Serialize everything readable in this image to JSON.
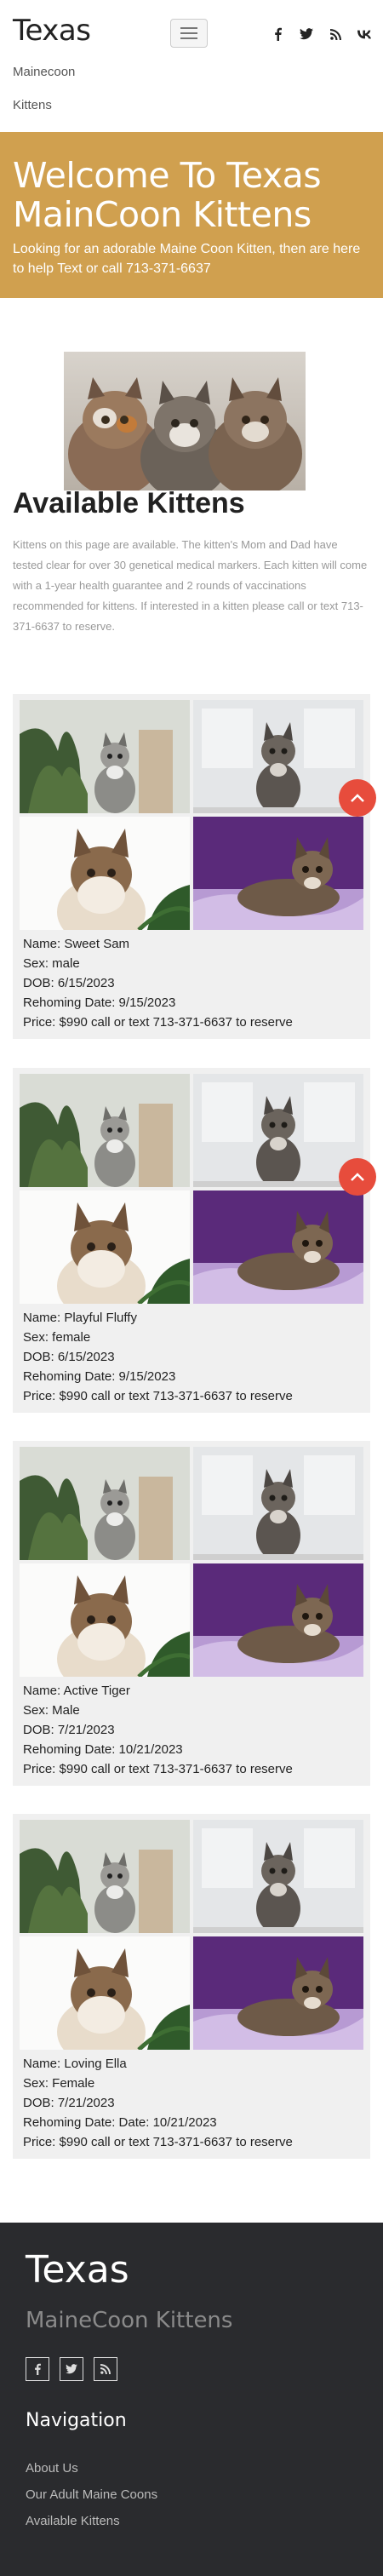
{
  "header": {
    "brand": "Texas",
    "nav": [
      "Mainecoon",
      "Kittens"
    ],
    "social_icons": [
      "facebook-icon",
      "twitter-icon",
      "rss-icon",
      "vk-icon"
    ]
  },
  "hero": {
    "title": "Welcome To Texas MainCoon Kittens",
    "subtitle": "Looking for an adorable Maine Coon Kitten, then are here to help Text or call 713-371-6637"
  },
  "intro": {
    "title": "Available Kittens",
    "text": "Kittens on this page are available. The kitten's Mom and Dad have tested clear for over 30 genetical medical markers. Each kitten will come with a 1-year health guarantee and 2 rounds of vaccinations recommended for kittens. If interested in a kitten please call or text 713-371-6637 to reserve."
  },
  "kittens": [
    {
      "name": "Name: Sweet Sam",
      "sex": "Sex: male",
      "dob": "DOB: 6/15/2023",
      "rehoming": "Rehoming Date: 9/15/2023",
      "price": "Price: $990 call or text 713-371-6637 to reserve"
    },
    {
      "name": "Name: Playful Fluffy",
      "sex": "Sex: female",
      "dob": "DOB: 6/15/2023",
      "rehoming": "Rehoming Date: 9/15/2023",
      "price": "Price: $990 call or text 713-371-6637 to reserve"
    },
    {
      "name": "Name: Active Tiger",
      "sex": "Sex: Male",
      "dob": "DOB: 7/21/2023",
      "rehoming": "Rehoming Date: 10/21/2023",
      "price": "Price: $990 call or text 713-371-6637 to reserve"
    },
    {
      "name": "Name: Loving Ella",
      "sex": "Sex: Female",
      "dob": "DOB: 7/21/2023",
      "rehoming": "Rehoming Date: Date: 10/21/2023",
      "price": "Price: $990 call or text 713-371-6637 to reserve"
    }
  ],
  "footer": {
    "title": "Texas",
    "subtitle": "MaineCoon Kittens",
    "social_icons": [
      "facebook-icon",
      "twitter-icon",
      "rss-icon"
    ],
    "nav_title": "Navigation",
    "links": [
      "About Us",
      "Our Adult Maine Coons",
      "Available Kittens"
    ]
  },
  "colors": {
    "hero_bg": "#d0a04f",
    "card_bg": "#f0f0f0",
    "footer_bg": "#2a2b2e",
    "fab": "#e74c3c"
  }
}
